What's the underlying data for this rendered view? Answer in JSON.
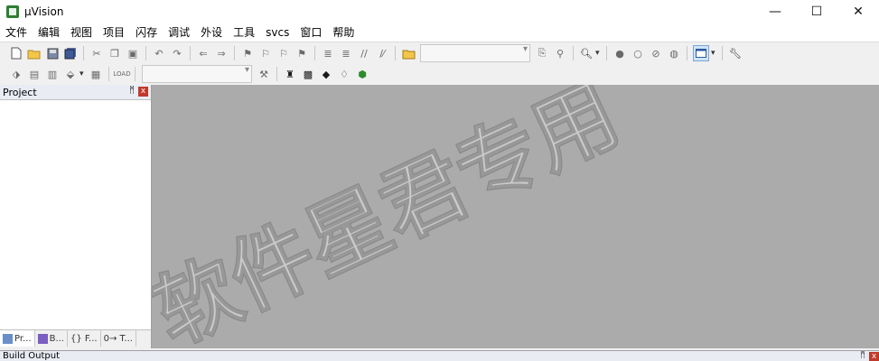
{
  "window": {
    "title": "µVision"
  },
  "title_controls": {
    "minimize": "—",
    "maximize": "☐",
    "close": "✕"
  },
  "menubar": [
    "文件",
    "编辑",
    "视图",
    "项目",
    "闪存",
    "调试",
    "外设",
    "工具",
    "svcs",
    "窗口",
    "帮助"
  ],
  "project_panel": {
    "title": "Project",
    "pin": "ᛗ",
    "close": "x",
    "tabs": [
      "Pr...",
      "B...",
      "{} F...",
      "0→ T..."
    ]
  },
  "build_output": {
    "title": "Build Output"
  },
  "watermark": "软件星君专用",
  "colors": {
    "editor_bg": "#ababab",
    "panel_header": "#e9ecf3",
    "close_red": "#c0392b"
  },
  "icons_toolbar1": [
    "new-file-icon",
    "open-folder-icon",
    "save-icon",
    "save-all-icon",
    "cut-icon",
    "copy-icon",
    "paste-icon",
    "undo-icon",
    "redo-icon",
    "nav-back-icon",
    "nav-forward-icon",
    "bookmark-toggle-icon",
    "bookmark-prev-icon",
    "bookmark-next-icon",
    "bookmark-clear-icon",
    "indent-icon",
    "unindent-icon",
    "comment-icon",
    "uncomment-icon",
    "find-in-files-icon",
    "find-icon",
    "incremental-find-icon",
    "debug-start-icon",
    "breakpoint-icon",
    "breakpoint-disable-icon",
    "breakpoint-kill-icon",
    "breakpoint-kill-all-icon",
    "window-layout-icon",
    "configure-icon"
  ],
  "icons_toolbar2": [
    "translate-icon",
    "build-icon",
    "rebuild-icon",
    "batch-build-icon",
    "stop-build-icon",
    "download-icon",
    "target-options-icon",
    "manage-components-icon",
    "select-packs-icon",
    "books-icon",
    "runtime-env-icon"
  ]
}
